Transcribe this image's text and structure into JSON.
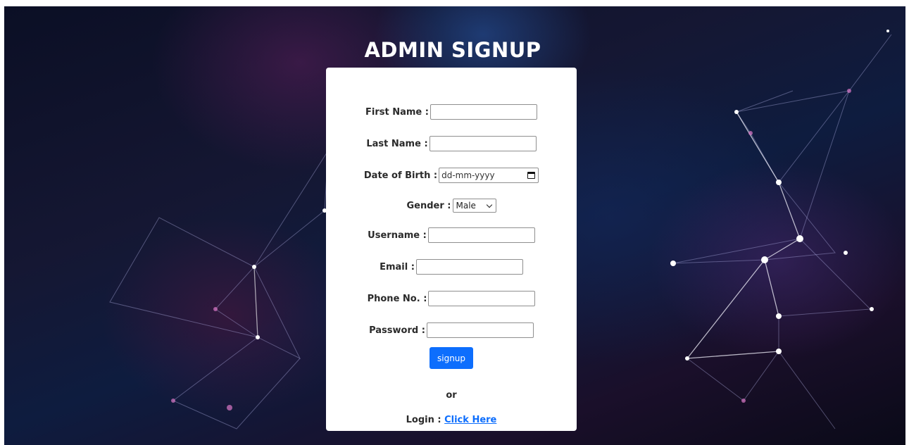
{
  "page": {
    "title": "ADMIN SIGNUP"
  },
  "form": {
    "first_name": {
      "label": "First Name",
      "value": ""
    },
    "last_name": {
      "label": "Last Name",
      "value": ""
    },
    "dob": {
      "label": "Date of Birth",
      "placeholder": "dd-mm-yyyy",
      "icon": "calendar-icon"
    },
    "gender": {
      "label": "Gender",
      "selected": "Male"
    },
    "username": {
      "label": "Username",
      "value": ""
    },
    "email": {
      "label": "Email",
      "value": ""
    },
    "phone": {
      "label": "Phone No.",
      "value": ""
    },
    "password": {
      "label": "Password",
      "value": ""
    },
    "submit_label": "signup"
  },
  "footer": {
    "or_text": "or",
    "login_prefix": "Login",
    "login_link": "Click Here"
  },
  "colors": {
    "button": "#0d6efd",
    "link": "#0d6efd",
    "card": "#ffffff"
  }
}
